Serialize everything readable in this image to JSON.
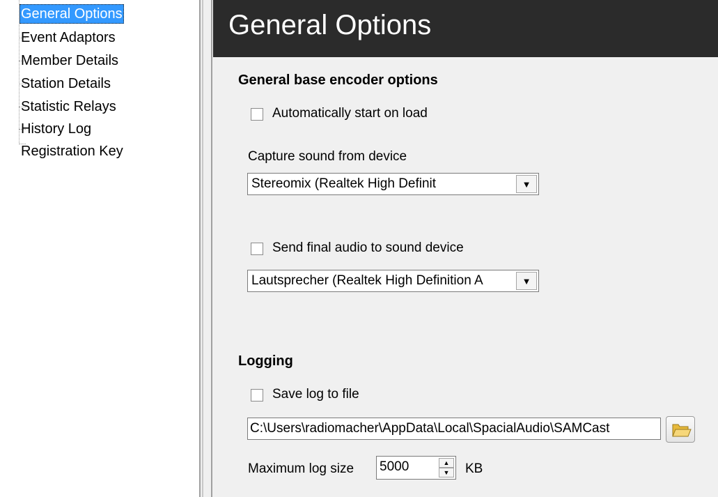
{
  "tree": {
    "items": [
      {
        "label": "General Options",
        "selected": true
      },
      {
        "label": "Event Adaptors",
        "selected": false
      },
      {
        "label": "Member Details",
        "selected": false
      },
      {
        "label": "Station Details",
        "selected": false
      },
      {
        "label": "Statistic Relays",
        "selected": false
      },
      {
        "label": "History Log",
        "selected": false
      },
      {
        "label": "Registration Key",
        "selected": false
      }
    ]
  },
  "panel": {
    "title": "General Options",
    "encoder": {
      "heading": "General base encoder options",
      "auto_start": {
        "label": "Automatically start on load",
        "checked": false
      },
      "capture_label": "Capture sound from device",
      "capture_device": "Stereomix (Realtek High Definit",
      "send_final": {
        "label": "Send final audio to sound device",
        "checked": false
      },
      "output_device": "Lautsprecher (Realtek High Definition A"
    },
    "logging": {
      "heading": "Logging",
      "save_log": {
        "label": "Save log to file",
        "checked": false
      },
      "log_path": "C:\\Users\\radiomacher\\AppData\\Local\\SpacialAudio\\SAMCast",
      "max_size_label": "Maximum log size",
      "max_size_value": "5000",
      "max_size_unit": "KB"
    }
  },
  "icons": {
    "dropdown": "chevron-down-icon",
    "folder": "folder-open-icon",
    "spin_up": "arrow-up-icon",
    "spin_down": "arrow-down-icon"
  },
  "colors": {
    "selection": "#3399ff",
    "header_bg": "#2b2b2b",
    "panel_bg": "#f0f0f0",
    "folder_icon": "#f2c94c"
  }
}
